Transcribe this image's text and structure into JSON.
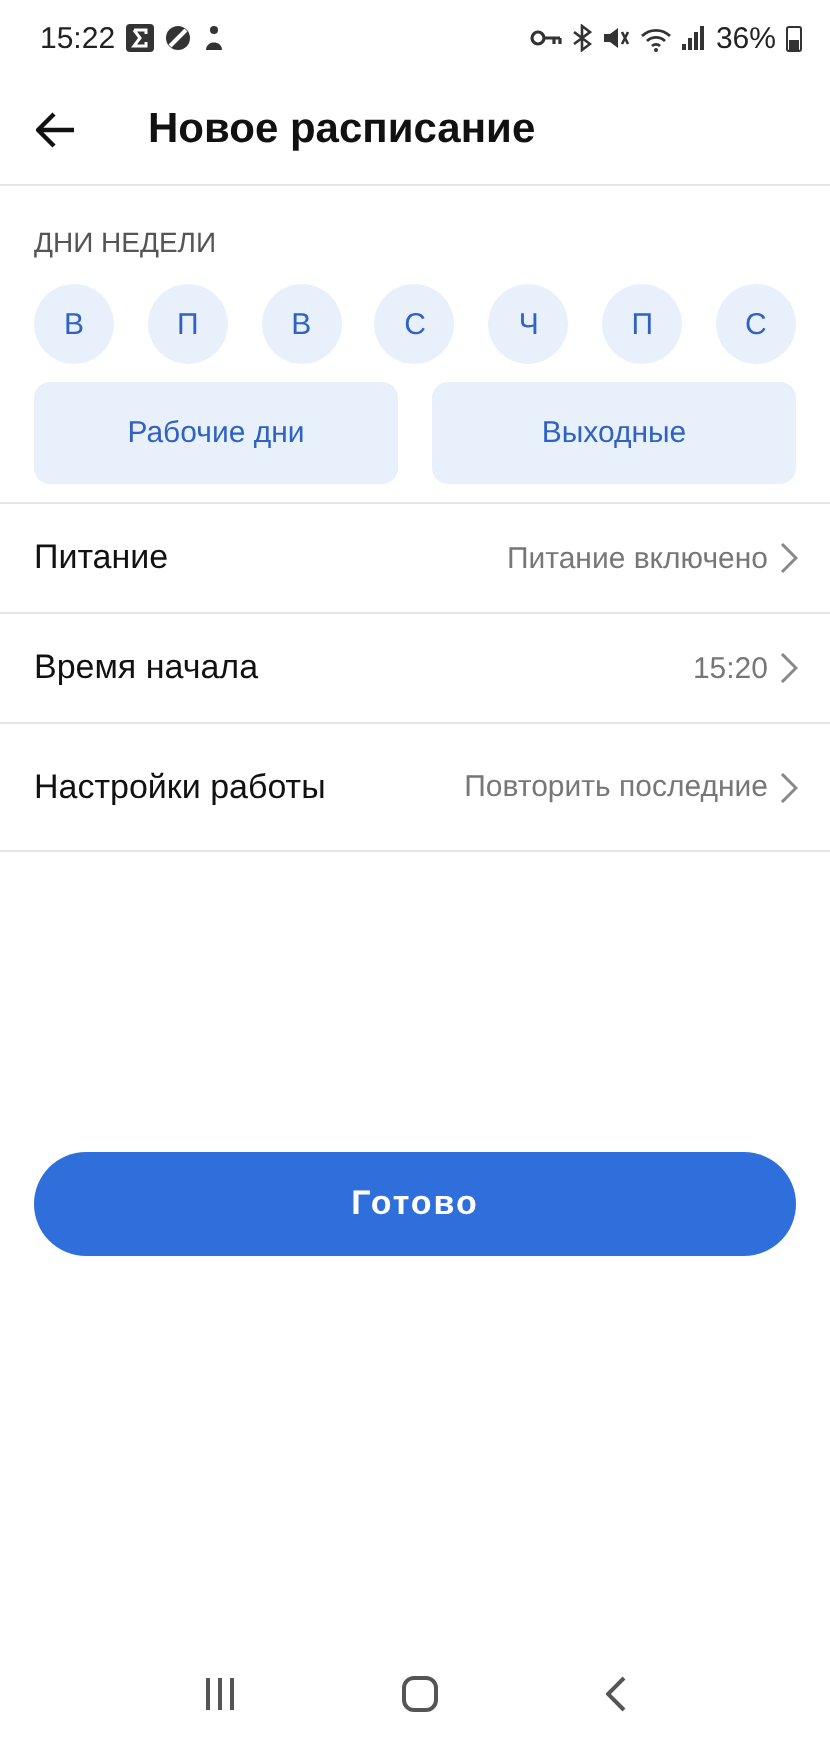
{
  "status_bar": {
    "time": "15:22",
    "battery": "36%"
  },
  "header": {
    "title": "Новое расписание"
  },
  "days": {
    "label": "ДНИ НЕДЕЛИ",
    "items": [
      {
        "label": "В",
        "selected": false
      },
      {
        "label": "П",
        "selected": false
      },
      {
        "label": "В",
        "selected": false
      },
      {
        "label": "С",
        "selected": false
      },
      {
        "label": "Ч",
        "selected": false
      },
      {
        "label": "П",
        "selected": false
      },
      {
        "label": "С",
        "selected": false
      }
    ],
    "presets": [
      {
        "label": "Рабочие дни",
        "selected": false
      },
      {
        "label": "Выходные",
        "selected": false
      }
    ]
  },
  "settings": [
    {
      "label": "Питание",
      "value": "Питание включено"
    },
    {
      "label": "Время начала",
      "value": "15:20"
    },
    {
      "label": "Настройки работы",
      "value": "Повторить последние"
    }
  ],
  "done_button": "Готово"
}
